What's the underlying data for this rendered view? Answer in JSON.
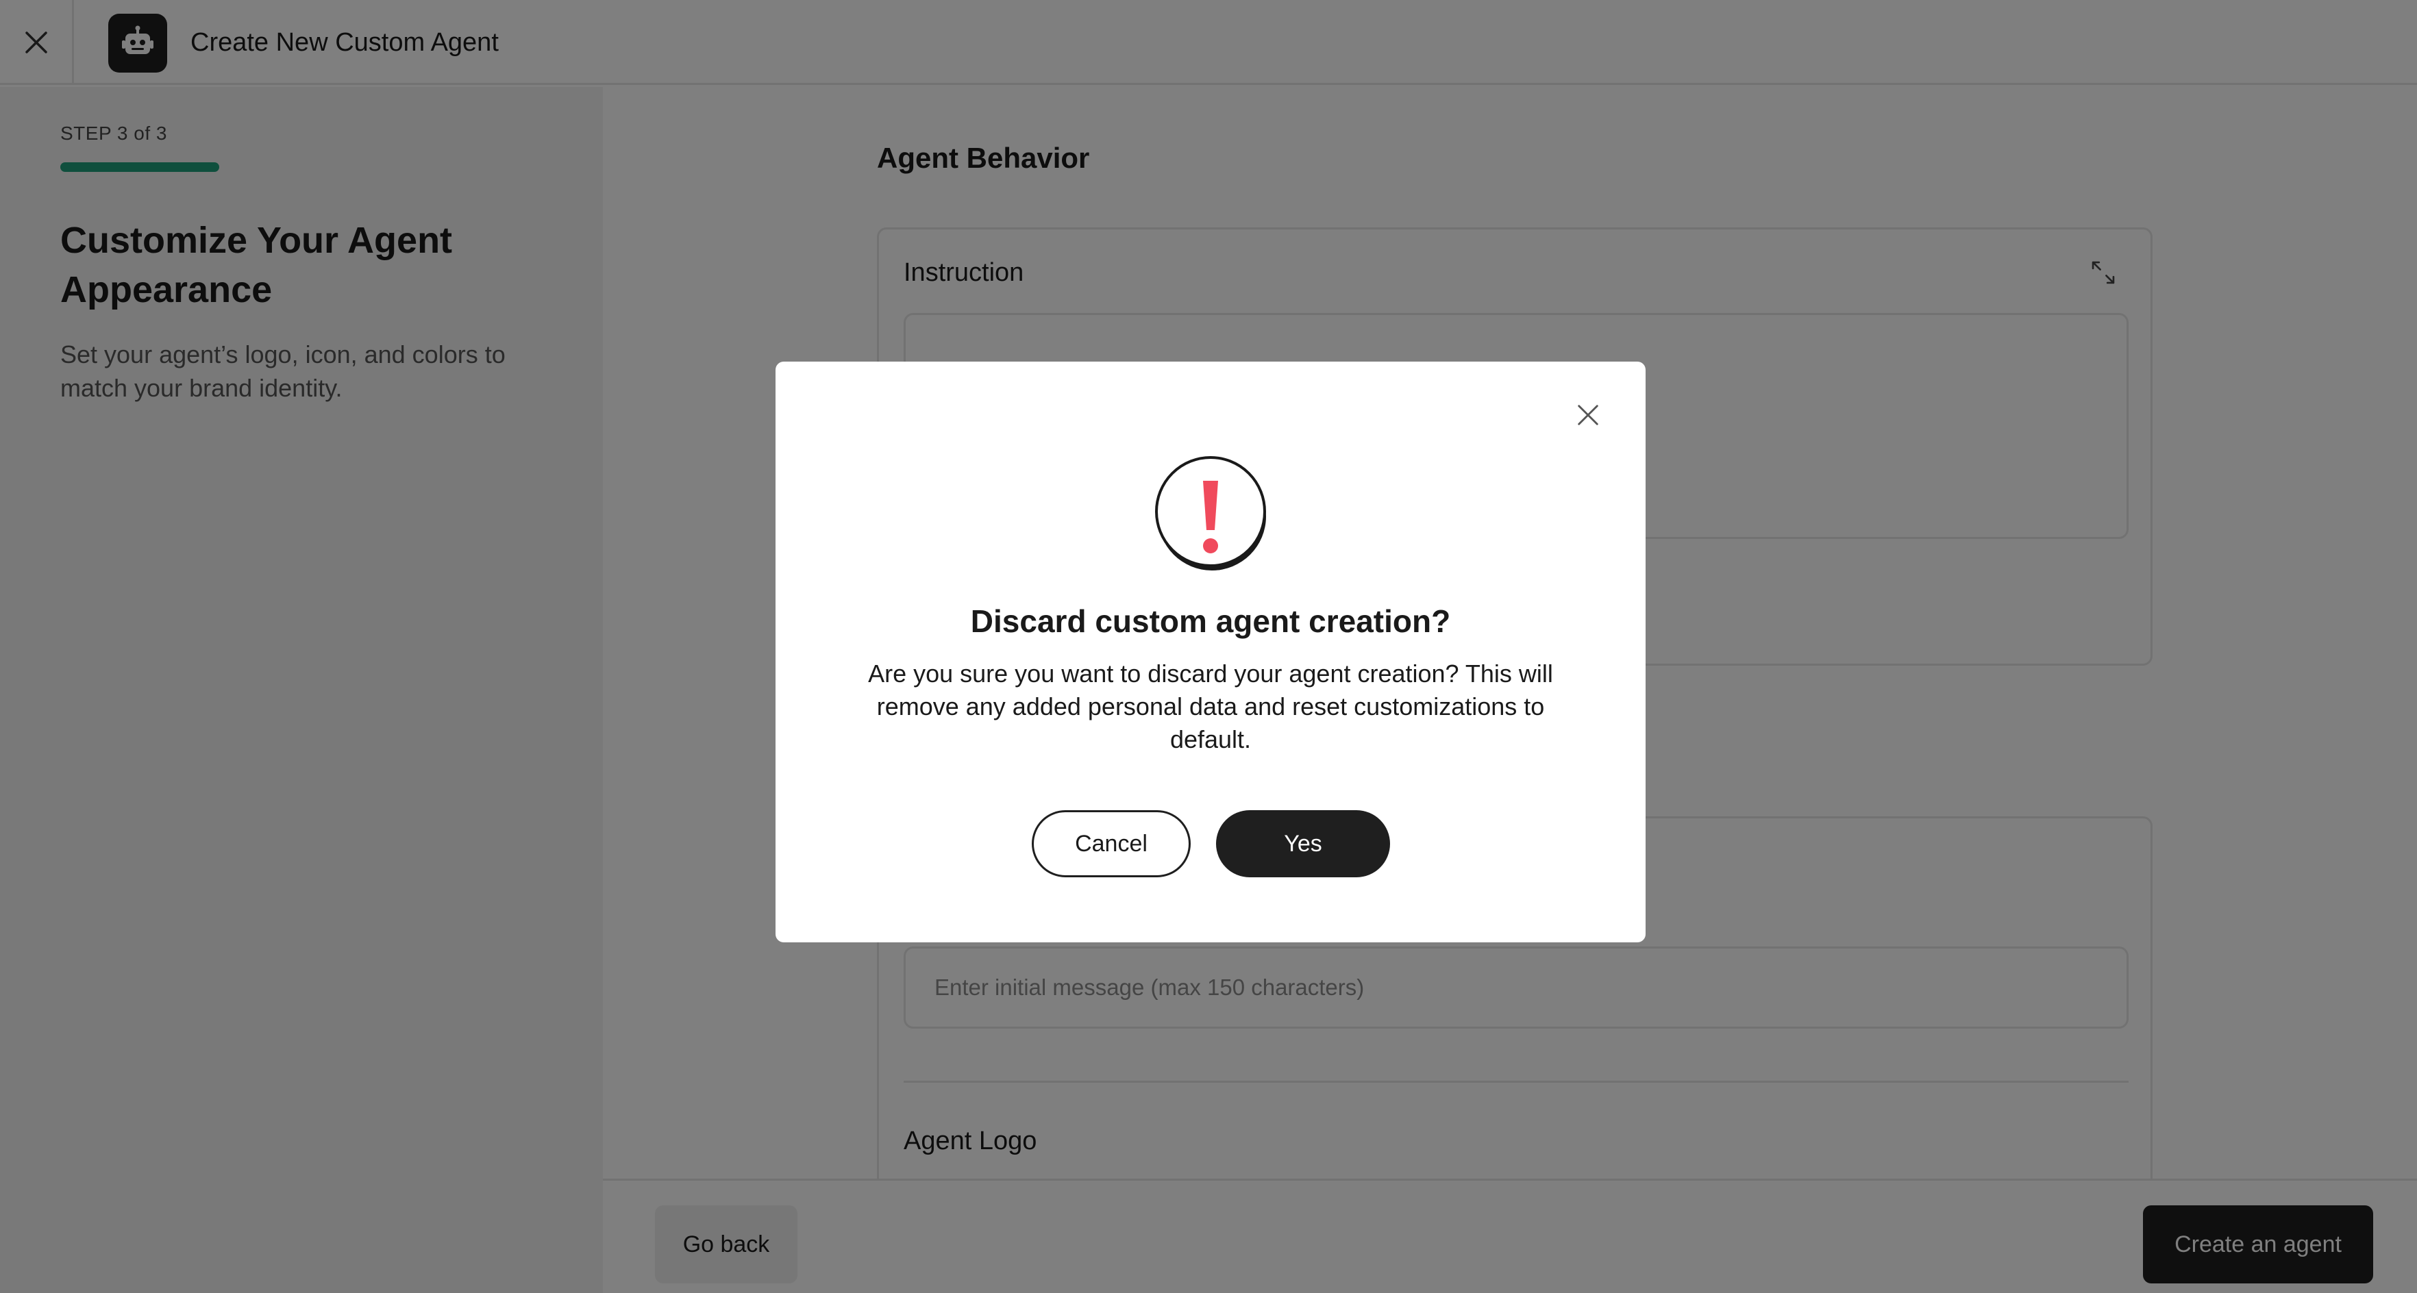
{
  "header": {
    "title": "Create New Custom Agent"
  },
  "left_panel": {
    "step_label": "STEP 3 of 3",
    "progress": 1.0,
    "heading": "Customize Your Agent Appearance",
    "description": "Set your agent’s logo, icon, and colors to match your brand identity."
  },
  "main": {
    "section_title": "Agent Behavior",
    "instruction_label": "Instruction",
    "initial_message_placeholder": "Enter initial message (max 150 characters)",
    "agent_logo_label": "Agent Logo"
  },
  "footer": {
    "go_back_label": "Go back",
    "create_label": "Create an agent"
  },
  "dialog": {
    "title": "Discard custom agent creation?",
    "message": "Are you sure you want to discard your agent creation? This will remove any added personal data and reset customizations to default.",
    "cancel_label": "Cancel",
    "confirm_label": "Yes"
  },
  "icons": {
    "close": "close-icon",
    "app_logo": "robot-icon",
    "expand": "expand-icon",
    "upload": "download-icon",
    "warning": "exclamation-icon"
  },
  "colors": {
    "accent": "#1f9e7a",
    "primary_button": "#1f1f1f",
    "warning": "#f04a5c"
  }
}
